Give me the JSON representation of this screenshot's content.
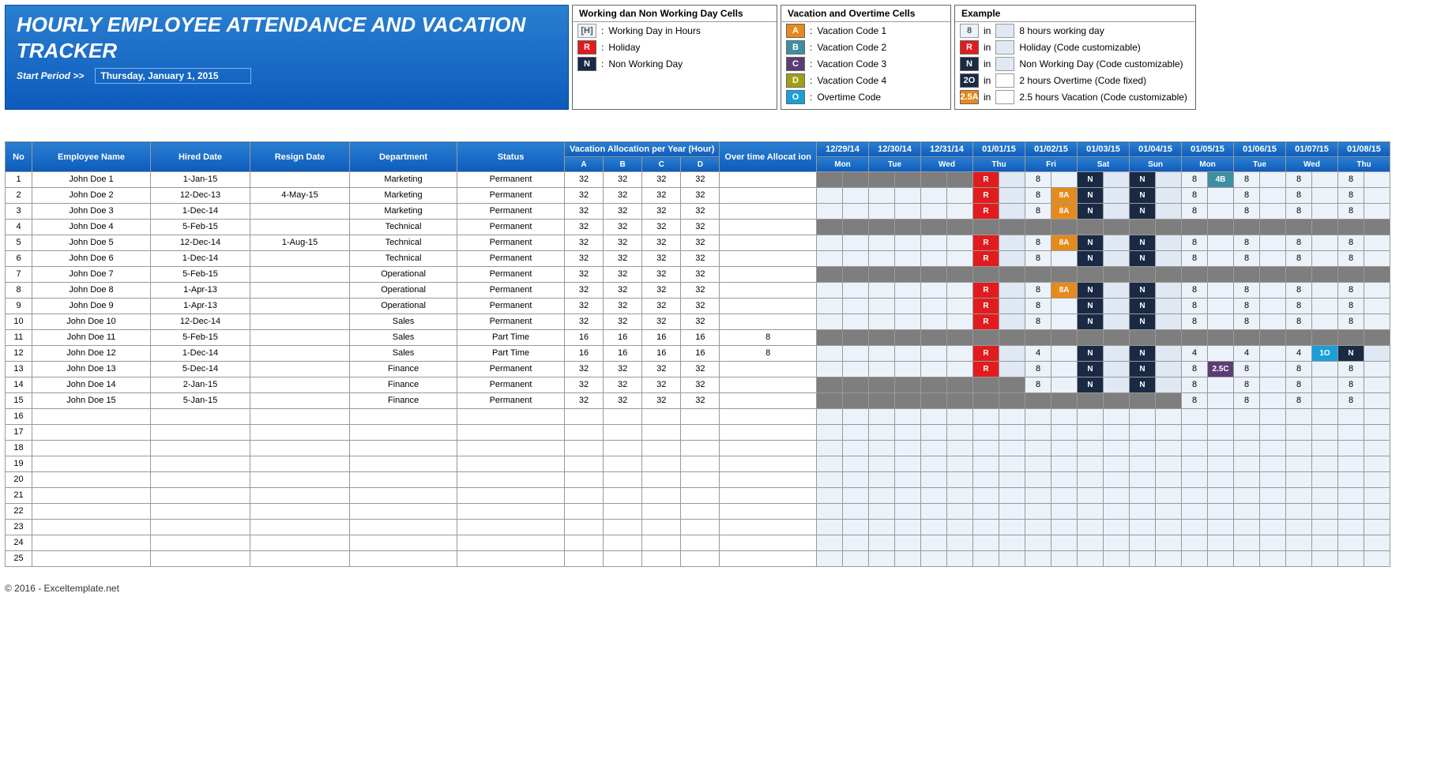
{
  "title_line1": "HOURLY EMPLOYEE ATTENDANCE AND VACATION",
  "title_line2": "TRACKER",
  "start_label": "Start Period >>",
  "start_date": "Thursday, January 1, 2015",
  "footer": "© 2016 - Exceltemplate.net",
  "legend_working": {
    "title": "Working dan Non Working Day Cells",
    "rows": [
      {
        "chip": "[H]",
        "cls": "chip-light",
        "desc": "Working Day in Hours"
      },
      {
        "chip": "R",
        "cls": "c-red",
        "desc": "Holiday"
      },
      {
        "chip": "N",
        "cls": "c-navy",
        "desc": "Non Working Day"
      }
    ]
  },
  "legend_vac": {
    "title": "Vacation and Overtime Cells",
    "rows": [
      {
        "chip": "A",
        "cls": "c-orange",
        "desc": "Vacation Code 1"
      },
      {
        "chip": "B",
        "cls": "c-teal",
        "desc": "Vacation Code 2"
      },
      {
        "chip": "C",
        "cls": "c-purple",
        "desc": "Vacation Code 3"
      },
      {
        "chip": "D",
        "cls": "c-olive",
        "desc": "Vacation Code 4"
      },
      {
        "chip": "O",
        "cls": "c-blue",
        "desc": "Overtime Code"
      }
    ]
  },
  "legend_ex": {
    "title": "Example",
    "rows": [
      {
        "chip": "8",
        "cls": "chip-light",
        "in": "in",
        "box": "chip-mid",
        "desc": "8 hours working day"
      },
      {
        "chip": "R",
        "cls": "c-red",
        "in": "in",
        "box": "chip-mid",
        "desc": "Holiday (Code customizable)"
      },
      {
        "chip": "N",
        "cls": "c-navy",
        "in": "in",
        "box": "chip-mid",
        "desc": "Non Working Day (Code customizable)"
      },
      {
        "chip": "2O",
        "cls": "c-navy",
        "in": "in",
        "box": "chip-empty",
        "desc": "2 hours Overtime (Code fixed)"
      },
      {
        "chip": "2.5A",
        "cls": "c-orange",
        "in": "in",
        "box": "chip-empty",
        "desc": "2.5 hours Vacation (Code customizable)"
      }
    ]
  },
  "headers": {
    "no": "No",
    "name": "Employee Name",
    "hired": "Hired Date",
    "resign": "Resign Date",
    "dept": "Department",
    "status": "Status",
    "vac": "Vacation Allocation per Year (Hour)",
    "ot": "Over time Allocat ion",
    "a": "A",
    "b": "B",
    "c": "C",
    "d": "D"
  },
  "dates": [
    {
      "d": "12/29/14",
      "w": "Mon"
    },
    {
      "d": "12/30/14",
      "w": "Tue"
    },
    {
      "d": "12/31/14",
      "w": "Wed"
    },
    {
      "d": "01/01/15",
      "w": "Thu"
    },
    {
      "d": "01/02/15",
      "w": "Fri"
    },
    {
      "d": "01/03/15",
      "w": "Sat"
    },
    {
      "d": "01/04/15",
      "w": "Sun"
    },
    {
      "d": "01/05/15",
      "w": "Mon"
    },
    {
      "d": "01/06/15",
      "w": "Tue"
    },
    {
      "d": "01/07/15",
      "w": "Wed"
    },
    {
      "d": "01/08/15",
      "w": "Thu"
    }
  ],
  "rows": [
    {
      "no": 1,
      "name": "John Doe 1",
      "hired": "1-Jan-15",
      "resign": "",
      "dept": "Marketing",
      "status": "Permanent",
      "vac": [
        32,
        32,
        32,
        32
      ],
      "ot": "",
      "days": [
        [
          "gray",
          "",
          ""
        ],
        [
          "gray",
          "",
          ""
        ],
        [
          "gray",
          "",
          ""
        ],
        [
          "R",
          "c-red",
          "mid"
        ],
        [
          "8",
          "",
          "lt"
        ],
        [
          "N",
          "c-navy",
          "mid"
        ],
        [
          "N",
          "c-navy",
          "mid"
        ],
        [
          "8",
          "4B",
          "lt",
          "c-teal"
        ],
        [
          "8",
          "",
          "lt"
        ],
        [
          "8",
          "",
          "lt"
        ],
        [
          "8",
          "",
          "lt"
        ]
      ]
    },
    {
      "no": 2,
      "name": "John Doe 2",
      "hired": "12-Dec-13",
      "resign": "4-May-15",
      "dept": "Marketing",
      "status": "Permanent",
      "vac": [
        32,
        32,
        32,
        32
      ],
      "ot": "",
      "days": [
        [
          "",
          "",
          "lt"
        ],
        [
          "",
          "",
          "lt"
        ],
        [
          "",
          "",
          "lt"
        ],
        [
          "R",
          "c-red",
          "mid"
        ],
        [
          "8",
          "8A",
          "lt",
          "c-orange"
        ],
        [
          "N",
          "c-navy",
          "mid"
        ],
        [
          "N",
          "c-navy",
          "mid"
        ],
        [
          "8",
          "",
          "lt"
        ],
        [
          "8",
          "",
          "lt"
        ],
        [
          "8",
          "",
          "lt"
        ],
        [
          "8",
          "",
          "lt"
        ]
      ]
    },
    {
      "no": 3,
      "name": "John Doe 3",
      "hired": "1-Dec-14",
      "resign": "",
      "dept": "Marketing",
      "status": "Permanent",
      "vac": [
        32,
        32,
        32,
        32
      ],
      "ot": "",
      "days": [
        [
          "",
          "",
          "lt"
        ],
        [
          "",
          "",
          "lt"
        ],
        [
          "",
          "",
          "lt"
        ],
        [
          "R",
          "c-red",
          "mid"
        ],
        [
          "8",
          "8A",
          "lt",
          "c-orange"
        ],
        [
          "N",
          "c-navy",
          "mid"
        ],
        [
          "N",
          "c-navy",
          "mid"
        ],
        [
          "8",
          "",
          "lt"
        ],
        [
          "8",
          "",
          "lt"
        ],
        [
          "8",
          "",
          "lt"
        ],
        [
          "8",
          "",
          "lt"
        ]
      ]
    },
    {
      "no": 4,
      "name": "John Doe 4",
      "hired": "5-Feb-15",
      "resign": "",
      "dept": "Technical",
      "status": "Permanent",
      "vac": [
        32,
        32,
        32,
        32
      ],
      "ot": "",
      "days": [
        [
          "gray",
          "",
          ""
        ],
        [
          "gray",
          "",
          ""
        ],
        [
          "gray",
          "",
          ""
        ],
        [
          "gray",
          "",
          ""
        ],
        [
          "gray",
          "",
          ""
        ],
        [
          "gray",
          "",
          ""
        ],
        [
          "gray",
          "",
          ""
        ],
        [
          "gray",
          "",
          ""
        ],
        [
          "gray",
          "",
          ""
        ],
        [
          "gray",
          "",
          ""
        ],
        [
          "gray",
          "",
          ""
        ]
      ]
    },
    {
      "no": 5,
      "name": "John Doe 5",
      "hired": "12-Dec-14",
      "resign": "1-Aug-15",
      "dept": "Technical",
      "status": "Permanent",
      "vac": [
        32,
        32,
        32,
        32
      ],
      "ot": "",
      "days": [
        [
          "",
          "",
          "lt"
        ],
        [
          "",
          "",
          "lt"
        ],
        [
          "",
          "",
          "lt"
        ],
        [
          "R",
          "c-red",
          "mid"
        ],
        [
          "8",
          "8A",
          "lt",
          "c-orange"
        ],
        [
          "N",
          "c-navy",
          "mid"
        ],
        [
          "N",
          "c-navy",
          "mid"
        ],
        [
          "8",
          "",
          "lt"
        ],
        [
          "8",
          "",
          "lt"
        ],
        [
          "8",
          "",
          "lt"
        ],
        [
          "8",
          "",
          "lt"
        ]
      ]
    },
    {
      "no": 6,
      "name": "John Doe 6",
      "hired": "1-Dec-14",
      "resign": "",
      "dept": "Technical",
      "status": "Permanent",
      "vac": [
        32,
        32,
        32,
        32
      ],
      "ot": "",
      "days": [
        [
          "",
          "",
          "lt"
        ],
        [
          "",
          "",
          "lt"
        ],
        [
          "",
          "",
          "lt"
        ],
        [
          "R",
          "c-red",
          "mid"
        ],
        [
          "8",
          "",
          "lt"
        ],
        [
          "N",
          "c-navy",
          "mid"
        ],
        [
          "N",
          "c-navy",
          "mid"
        ],
        [
          "8",
          "",
          "lt"
        ],
        [
          "8",
          "",
          "lt"
        ],
        [
          "8",
          "",
          "lt"
        ],
        [
          "8",
          "",
          "lt"
        ]
      ]
    },
    {
      "no": 7,
      "name": "John Doe 7",
      "hired": "5-Feb-15",
      "resign": "",
      "dept": "Operational",
      "status": "Permanent",
      "vac": [
        32,
        32,
        32,
        32
      ],
      "ot": "",
      "days": [
        [
          "gray",
          "",
          ""
        ],
        [
          "gray",
          "",
          ""
        ],
        [
          "gray",
          "",
          ""
        ],
        [
          "gray",
          "",
          ""
        ],
        [
          "gray",
          "",
          ""
        ],
        [
          "gray",
          "",
          ""
        ],
        [
          "gray",
          "",
          ""
        ],
        [
          "gray",
          "",
          ""
        ],
        [
          "gray",
          "",
          ""
        ],
        [
          "gray",
          "",
          ""
        ],
        [
          "gray",
          "",
          ""
        ]
      ]
    },
    {
      "no": 8,
      "name": "John Doe 8",
      "hired": "1-Apr-13",
      "resign": "",
      "dept": "Operational",
      "status": "Permanent",
      "vac": [
        32,
        32,
        32,
        32
      ],
      "ot": "",
      "days": [
        [
          "",
          "",
          "lt"
        ],
        [
          "",
          "",
          "lt"
        ],
        [
          "",
          "",
          "lt"
        ],
        [
          "R",
          "c-red",
          "mid"
        ],
        [
          "8",
          "8A",
          "lt",
          "c-orange"
        ],
        [
          "N",
          "c-navy",
          "mid"
        ],
        [
          "N",
          "c-navy",
          "mid"
        ],
        [
          "8",
          "",
          "lt"
        ],
        [
          "8",
          "",
          "lt"
        ],
        [
          "8",
          "",
          "lt"
        ],
        [
          "8",
          "",
          "lt"
        ]
      ]
    },
    {
      "no": 9,
      "name": "John Doe 9",
      "hired": "1-Apr-13",
      "resign": "",
      "dept": "Operational",
      "status": "Permanent",
      "vac": [
        32,
        32,
        32,
        32
      ],
      "ot": "",
      "days": [
        [
          "",
          "",
          "lt"
        ],
        [
          "",
          "",
          "lt"
        ],
        [
          "",
          "",
          "lt"
        ],
        [
          "R",
          "c-red",
          "mid"
        ],
        [
          "8",
          "",
          "lt"
        ],
        [
          "N",
          "c-navy",
          "mid"
        ],
        [
          "N",
          "c-navy",
          "mid"
        ],
        [
          "8",
          "",
          "lt"
        ],
        [
          "8",
          "",
          "lt"
        ],
        [
          "8",
          "",
          "lt"
        ],
        [
          "8",
          "",
          "lt"
        ]
      ]
    },
    {
      "no": 10,
      "name": "John Doe 10",
      "hired": "12-Dec-14",
      "resign": "",
      "dept": "Sales",
      "status": "Permanent",
      "vac": [
        32,
        32,
        32,
        32
      ],
      "ot": "",
      "days": [
        [
          "",
          "",
          "lt"
        ],
        [
          "",
          "",
          "lt"
        ],
        [
          "",
          "",
          "lt"
        ],
        [
          "R",
          "c-red",
          "mid"
        ],
        [
          "8",
          "",
          "lt"
        ],
        [
          "N",
          "c-navy",
          "mid"
        ],
        [
          "N",
          "c-navy",
          "mid"
        ],
        [
          "8",
          "",
          "lt"
        ],
        [
          "8",
          "",
          "lt"
        ],
        [
          "8",
          "",
          "lt"
        ],
        [
          "8",
          "",
          "lt"
        ]
      ]
    },
    {
      "no": 11,
      "name": "John Doe 11",
      "hired": "5-Feb-15",
      "resign": "",
      "dept": "Sales",
      "status": "Part Time",
      "vac": [
        16,
        16,
        16,
        16
      ],
      "ot": "8",
      "days": [
        [
          "gray",
          "",
          ""
        ],
        [
          "gray",
          "",
          ""
        ],
        [
          "gray",
          "",
          ""
        ],
        [
          "gray",
          "",
          ""
        ],
        [
          "gray",
          "",
          ""
        ],
        [
          "gray",
          "",
          ""
        ],
        [
          "gray",
          "",
          ""
        ],
        [
          "gray",
          "",
          ""
        ],
        [
          "gray",
          "",
          ""
        ],
        [
          "gray",
          "",
          ""
        ],
        [
          "gray",
          "",
          ""
        ]
      ]
    },
    {
      "no": 12,
      "name": "John Doe 12",
      "hired": "1-Dec-14",
      "resign": "",
      "dept": "Sales",
      "status": "Part Time",
      "vac": [
        16,
        16,
        16,
        16
      ],
      "ot": "8",
      "days": [
        [
          "",
          "",
          "lt"
        ],
        [
          "",
          "",
          "lt"
        ],
        [
          "",
          "",
          "lt"
        ],
        [
          "R",
          "c-red",
          "mid"
        ],
        [
          "4",
          "",
          "lt"
        ],
        [
          "N",
          "c-navy",
          "mid"
        ],
        [
          "N",
          "c-navy",
          "mid"
        ],
        [
          "4",
          "",
          "lt"
        ],
        [
          "4",
          "",
          "lt"
        ],
        [
          "4",
          "1O",
          "lt",
          "c-blue"
        ],
        [
          "N",
          "c-navy",
          "mid"
        ]
      ]
    },
    {
      "no": 13,
      "name": "John Doe 13",
      "hired": "5-Dec-14",
      "resign": "",
      "dept": "Finance",
      "status": "Permanent",
      "vac": [
        32,
        32,
        32,
        32
      ],
      "ot": "",
      "days": [
        [
          "",
          "",
          "lt"
        ],
        [
          "",
          "",
          "lt"
        ],
        [
          "",
          "",
          "lt"
        ],
        [
          "R",
          "c-red",
          "mid"
        ],
        [
          "8",
          "",
          "lt"
        ],
        [
          "N",
          "c-navy",
          "mid"
        ],
        [
          "N",
          "c-navy",
          "mid"
        ],
        [
          "8",
          "2.5C",
          "lt",
          "c-purple"
        ],
        [
          "8",
          "",
          "lt"
        ],
        [
          "8",
          "",
          "lt"
        ],
        [
          "8",
          "",
          "lt"
        ]
      ]
    },
    {
      "no": 14,
      "name": "John Doe 14",
      "hired": "2-Jan-15",
      "resign": "",
      "dept": "Finance",
      "status": "Permanent",
      "vac": [
        32,
        32,
        32,
        32
      ],
      "ot": "",
      "days": [
        [
          "gray",
          "",
          ""
        ],
        [
          "gray",
          "",
          ""
        ],
        [
          "gray",
          "",
          ""
        ],
        [
          "gray",
          "",
          ""
        ],
        [
          "8",
          "",
          "lt"
        ],
        [
          "N",
          "c-navy",
          "mid"
        ],
        [
          "N",
          "c-navy",
          "mid"
        ],
        [
          "8",
          "",
          "lt"
        ],
        [
          "8",
          "",
          "lt"
        ],
        [
          "8",
          "",
          "lt"
        ],
        [
          "8",
          "",
          "lt"
        ]
      ]
    },
    {
      "no": 15,
      "name": "John Doe 15",
      "hired": "5-Jan-15",
      "resign": "",
      "dept": "Finance",
      "status": "Permanent",
      "vac": [
        32,
        32,
        32,
        32
      ],
      "ot": "",
      "days": [
        [
          "gray",
          "",
          ""
        ],
        [
          "gray",
          "",
          ""
        ],
        [
          "gray",
          "",
          ""
        ],
        [
          "gray",
          "",
          ""
        ],
        [
          "gray",
          "",
          ""
        ],
        [
          "gray",
          "",
          ""
        ],
        [
          "gray",
          "",
          ""
        ],
        [
          "8",
          "",
          "lt"
        ],
        [
          "8",
          "",
          "lt"
        ],
        [
          "8",
          "",
          "lt"
        ],
        [
          "8",
          "",
          "lt"
        ]
      ]
    }
  ],
  "empty_rows": [
    16,
    17,
    18,
    19,
    20,
    21,
    22,
    23,
    24,
    25
  ]
}
